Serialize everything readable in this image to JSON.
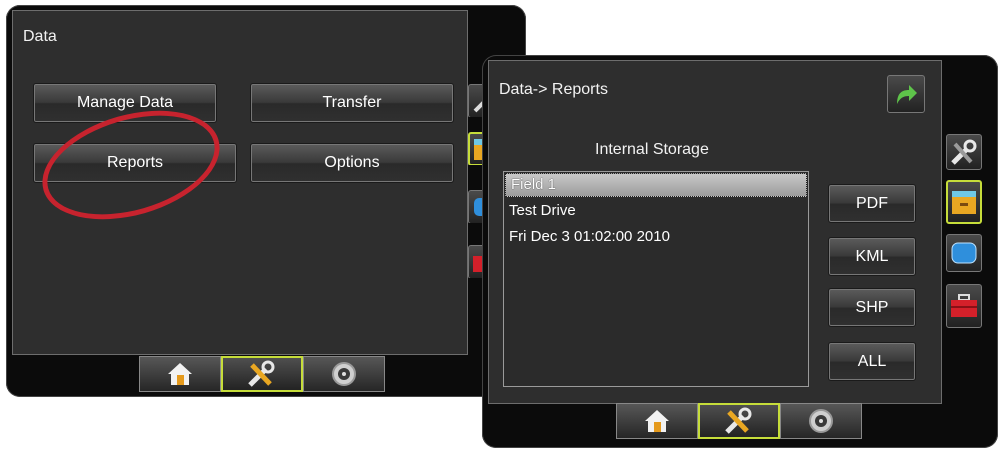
{
  "data_screen": {
    "title": "Data",
    "buttons": {
      "manage_data": "Manage Data",
      "transfer": "Transfer",
      "reports": "Reports",
      "options": "Options"
    }
  },
  "reports_screen": {
    "title": "Data-> Reports",
    "storage_label": "Internal Storage",
    "items": [
      "Field 1",
      "Test Drive",
      "Fri Dec 3 01:02:00 2010"
    ],
    "selected_item": "Field 1",
    "format_buttons": [
      "PDF",
      "KML",
      "SHP",
      "ALL"
    ]
  },
  "bottom_tabs": [
    "home-icon",
    "tools-icon",
    "gauge-icon"
  ],
  "side_tabs": [
    "tools-icon",
    "data-drawer-icon",
    "screen-icon",
    "toolbox-icon"
  ],
  "colors": {
    "accent_selected": "#c6dd3a",
    "highlight_oval": "#c7232e",
    "back_arrow": "#5ec44a",
    "screen_bg": "#2e2e2e"
  }
}
